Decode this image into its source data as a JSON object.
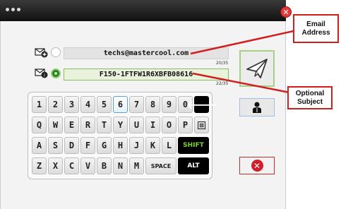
{
  "titlebar": {
    "close_glyph": "✕"
  },
  "fields": [
    {
      "icon": "email-add-icon",
      "value": "techs@mastercool.com",
      "selected": false,
      "counter": "20/35"
    },
    {
      "icon": "subject-icon",
      "value": "F150-1FTFW1R6XBFB08616",
      "selected": true,
      "counter": "22/35"
    }
  ],
  "keyboard": {
    "rows": [
      [
        "1",
        "2",
        "3",
        "4",
        "5",
        "6",
        "7",
        "8",
        "9",
        "0",
        "🡐"
      ],
      [
        "Q",
        "W",
        "E",
        "R",
        "T",
        "Y",
        "U",
        "I",
        "O",
        "P",
        "⊠"
      ],
      [
        "A",
        "S",
        "D",
        "F",
        "G",
        "H",
        "J",
        "K",
        "L",
        "SHIFT"
      ],
      [
        "Z",
        "X",
        "C",
        "V",
        "B",
        "N",
        "M",
        "SPACE",
        "ALT"
      ]
    ],
    "selected_key": "6"
  },
  "buttons": {
    "send": "paper-plane-icon",
    "profile": "person-icon",
    "cancel_glyph": "✕"
  },
  "callouts": {
    "email": "Email Address",
    "subject": "Optional Subject"
  },
  "colors": {
    "titlebar": "#1a1a1a",
    "accent_green": "#8fd46a",
    "close_red": "#d11f2a",
    "callout_red": "#d11f1f"
  }
}
